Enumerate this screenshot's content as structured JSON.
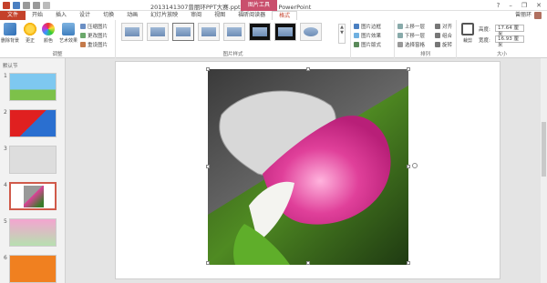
{
  "window": {
    "title": "2013141307曾丽环PPT大赛.pptx - Microsoft PowerPoint",
    "context_header": "图片工具",
    "buttons": [
      "?",
      "–",
      "❐",
      "✕"
    ]
  },
  "tabs": [
    {
      "label": "文件",
      "kind": "file"
    },
    {
      "label": "开始"
    },
    {
      "label": "插入"
    },
    {
      "label": "设计"
    },
    {
      "label": "切换"
    },
    {
      "label": "动画"
    },
    {
      "label": "幻灯片放映"
    },
    {
      "label": "审阅"
    },
    {
      "label": "视图"
    },
    {
      "label": "福昕阅读器"
    },
    {
      "label": "格式",
      "active": true
    }
  ],
  "user": {
    "name": "曾丽环"
  },
  "ribbon": {
    "adjust": {
      "remove_bg": "删除背景",
      "corrections": "更正",
      "color": "颜色",
      "artistic": "艺术效果",
      "compress": "压缩图片",
      "change": "更改图片",
      "reset": "重设图片",
      "label": "调整"
    },
    "styles": {
      "label": "图片样式"
    },
    "picture_opts": {
      "border": "图片边框",
      "effects": "图片效果",
      "layout": "图片版式"
    },
    "arrange": {
      "forward": "上移一层",
      "backward": "下移一层",
      "selection": "选择窗格",
      "align": "对齐",
      "group": "组合",
      "rotate": "旋转",
      "label": "排列"
    },
    "size": {
      "crop": "裁剪",
      "height_label": "高度:",
      "height": "17.64 厘米",
      "width_label": "宽度:",
      "width": "16.93 厘米",
      "label": "大小"
    }
  },
  "slides_pane": {
    "section": "默认节",
    "numbers": [
      "1",
      "2",
      "3",
      "4",
      "5",
      "6"
    ]
  },
  "colors": {
    "accent": "#c4412a",
    "context": "#c94f6d",
    "flower_pink": "#e0409a"
  }
}
